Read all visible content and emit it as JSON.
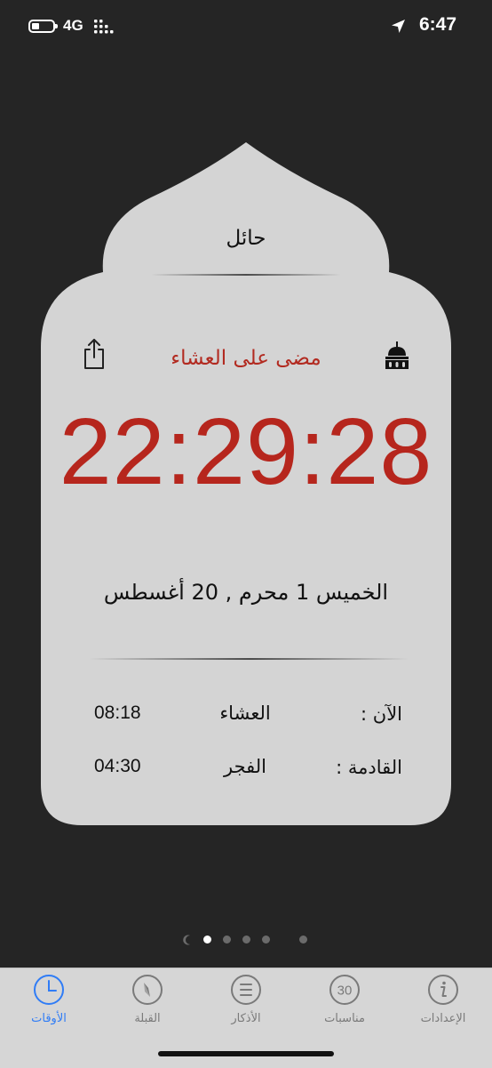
{
  "status_bar": {
    "network": "4G",
    "time": "6:47",
    "battery_level": 0.35
  },
  "card": {
    "city": "حائل",
    "since_label": "مضى على العشاء",
    "timer": "22:29:28",
    "date_line": "الخميس  1 محرم , 20 أغسطس",
    "current": {
      "label": "الآن :",
      "prayer": "العشاء",
      "time": "08:18"
    },
    "next": {
      "label": "القادمة :",
      "prayer": "الفجر",
      "time": "04:30"
    }
  },
  "page_indicator": {
    "count": 6,
    "active_index": 1
  },
  "tabs": [
    {
      "label": "الإعدادات",
      "icon": "info-icon"
    },
    {
      "label": "مناسبات",
      "icon": "thirty-icon",
      "icon_text": "30"
    },
    {
      "label": "الأذكار",
      "icon": "list-icon"
    },
    {
      "label": "القبلة",
      "icon": "compass-icon"
    },
    {
      "label": "الأوقات",
      "icon": "clock-icon"
    }
  ],
  "colors": {
    "background": "#252525",
    "card": "#d4d4d4",
    "accent_red": "#b6261d",
    "tab_active": "#2f7cf6",
    "tab_inactive": "#7a7a7a"
  }
}
